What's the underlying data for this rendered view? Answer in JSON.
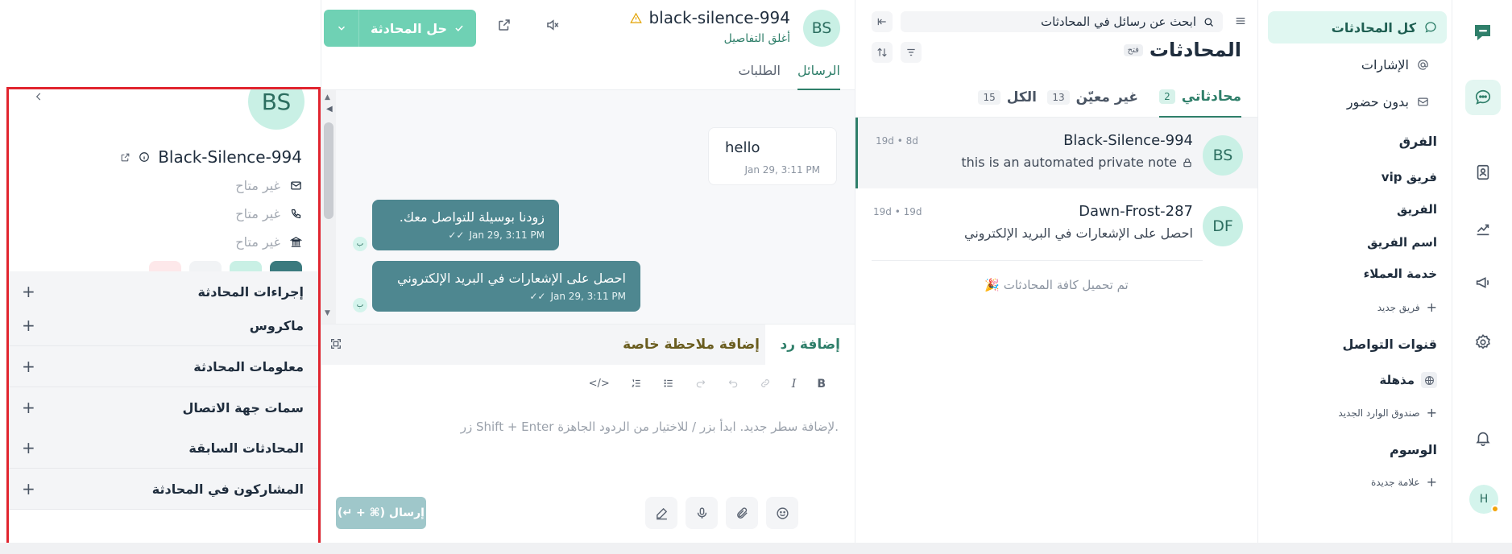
{
  "primary_sidebar": {
    "avatar_initial": "H"
  },
  "secondary_sidebar": {
    "all_conversations": "كل المحادثات",
    "mentions": "الإشارات",
    "unattended": "بدون حضور",
    "teams_heading": "الفرق",
    "teams": [
      "فريق vip",
      "الفريق",
      "اسم الفريق",
      "خدمة العملاء"
    ],
    "new_team": "فريق جديد",
    "channels_heading": "قنوات التواصل",
    "channels": [
      "مذهلة"
    ],
    "new_inbox": "صندوق الوارد الجديد",
    "labels_heading": "الوسوم",
    "new_label": "علامة جديدة"
  },
  "conversation_list": {
    "search_placeholder": "ابحث عن رسائل في المحادثات",
    "title": "المحادثات",
    "status_chip": "فتح",
    "tabs": [
      {
        "label": "محادثاتي",
        "count": "2"
      },
      {
        "label": "غير معيّن",
        "count": "13"
      },
      {
        "label": "الكل",
        "count": "15"
      }
    ],
    "items": [
      {
        "initials": "BS",
        "name": "Black-Silence-994",
        "preview": "this is an automated private note",
        "time": "19d • 8d"
      },
      {
        "initials": "DF",
        "name": "Dawn-Frost-287",
        "preview": "احصل على الإشعارات في البريد الإلكتروني",
        "time": "19d • 19d"
      }
    ],
    "all_loaded": "تم تحميل كافة المحادثات"
  },
  "chat": {
    "initials": "BS",
    "name": "black-silence-994",
    "close_details": "أغلق التفاصيل",
    "tabs": [
      "الرسائل",
      "الطلبات"
    ],
    "resolve_label": "حل المحادثة",
    "messages": {
      "incoming": {
        "text": "hello",
        "time": "Jan 29, 3:11 PM"
      },
      "outgoing": [
        {
          "text": "زودنا بوسيلة للتواصل معك.",
          "time": "Jan 29, 3:11 PM",
          "avatar": "ب"
        },
        {
          "text": "احصل على الإشعارات في البريد الإلكتروني",
          "time": "Jan 29, 3:11 PM",
          "avatar": "ب"
        }
      ]
    },
    "reply_tabs": [
      "إضافة رد",
      "إضافة ملاحظة خاصة"
    ],
    "toolbar": [
      "B",
      "I"
    ],
    "placeholder": "زر Shift + Enter لإضافة سطر جديد. ابدأ بزر / للاختيار من الردود الجاهزة.",
    "send_label": "إرسال (⌘ + ↵)"
  },
  "contact": {
    "initials": "BS",
    "name": "Black-Silence-994",
    "email": "غير متاح",
    "phone": "غير متاح",
    "company": "غير متاح",
    "sections": [
      "إجراءات المحادثة",
      "ماكروس",
      "معلومات المحادثة",
      "سمات جهة الاتصال",
      "المحادثات السابقة",
      "المشاركون في المحادثة"
    ]
  },
  "colors": {
    "accent": "#2f7f6a",
    "resolve_button": "#6fd1b4",
    "outgoing_bubble": "#4e8790",
    "highlight_border": "#e1252f"
  }
}
